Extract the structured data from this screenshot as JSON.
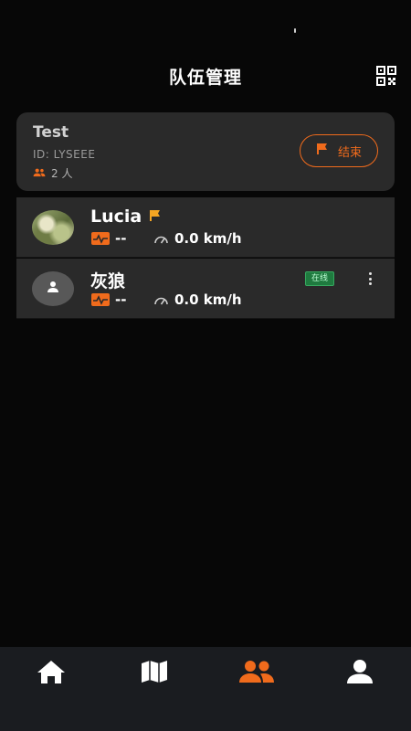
{
  "header": {
    "title": "队伍管理",
    "qr_icon": "qr-code-icon"
  },
  "team": {
    "name": "Test",
    "id_text": "ID: LYSEEE",
    "member_count": "2 人",
    "end_label": "结束"
  },
  "members": [
    {
      "name": "Lucia",
      "leader_flag": true,
      "heart_rate": "--",
      "speed": "0.0 km/h",
      "avatar": "photo"
    },
    {
      "name": "灰狼",
      "online_label": "在线",
      "heart_rate": "--",
      "speed": "0.0 km/h",
      "avatar": "default-user"
    }
  ],
  "tabs": [
    {
      "name": "home",
      "icon": "home-icon",
      "active": false
    },
    {
      "name": "map",
      "icon": "map-icon",
      "active": false
    },
    {
      "name": "team",
      "icon": "group-icon",
      "active": true
    },
    {
      "name": "profile",
      "icon": "person-icon",
      "active": false
    }
  ],
  "colors": {
    "accent": "#f06b1c",
    "flag": "#f5a623",
    "card": "#2a2a2a",
    "background": "#070707",
    "tab_bar": "#1a1c20",
    "online": "#1f7a3f"
  }
}
